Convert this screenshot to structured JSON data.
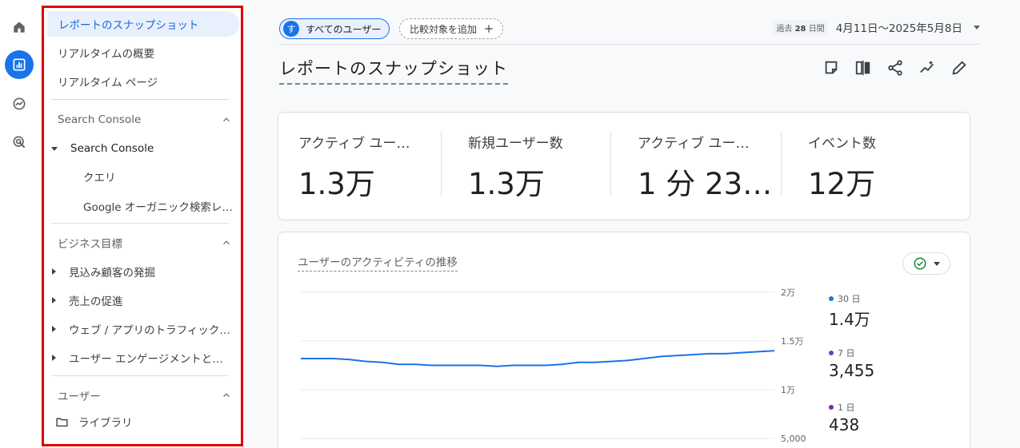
{
  "rail": {
    "items": [
      {
        "icon": "home-icon"
      },
      {
        "icon": "reports-icon",
        "active": true
      },
      {
        "icon": "explore-icon"
      },
      {
        "icon": "advertising-icon"
      }
    ]
  },
  "sidebar": {
    "snapshot": "レポートのスナップショット",
    "realtime_overview": "リアルタイムの概要",
    "realtime_pages": "リアルタイム ページ",
    "search_console_section": "Search Console",
    "search_console_group": "Search Console",
    "queries": "クエリ",
    "google_organic": "Google オーガニック検索レ…",
    "business_section": "ビジネス目標",
    "leads": "見込み顧客の発掘",
    "sales": "売上の促進",
    "traffic": "ウェブ / アプリのトラフィック…",
    "engagement": "ユーザー エンゲージメントと…",
    "user_section": "ユーザー",
    "library": "ライブラリ"
  },
  "header": {
    "user_chip_avatar": "す",
    "user_chip_label": "すべてのユーザー",
    "compare_label": "比較対象を追加",
    "date_badge_prefix": "過去",
    "date_badge_days": "28",
    "date_badge_suffix": "日間",
    "date_range": "4月11日～2025年5月8日",
    "page_title": "レポートのスナップショット"
  },
  "metrics": [
    {
      "label": "アクティブ ユー…",
      "value": "1.3万"
    },
    {
      "label": "新規ユーザー数",
      "value": "1.3万"
    },
    {
      "label": "アクティブ ユー…",
      "value": "1 分 23…"
    },
    {
      "label": "イベント数",
      "value": "12万"
    }
  ],
  "chart": {
    "title": "ユーザーのアクティビティの推移",
    "legend": [
      {
        "label": "30 日",
        "value": "1.4万",
        "color": "#1a73e8"
      },
      {
        "label": "7 日",
        "value": "3,455",
        "color": "#5a47c9"
      },
      {
        "label": "1 日",
        "value": "438",
        "color": "#7b2ab3"
      }
    ]
  },
  "chart_data": {
    "type": "line",
    "title": "ユーザーのアクティビティの推移",
    "y_ticks": [
      "2万",
      "1.5万",
      "1万",
      "5,000"
    ],
    "ylim": [
      5000,
      20000
    ],
    "grid": true,
    "series": [
      {
        "name": "30 日",
        "values": [
          13200,
          13200,
          13200,
          13100,
          12900,
          12800,
          12600,
          12600,
          12500,
          12500,
          12500,
          12500,
          12400,
          12500,
          12500,
          12500,
          12600,
          12800,
          12800,
          12900,
          13000,
          13200,
          13400,
          13500,
          13600,
          13700,
          13700,
          13800,
          13900,
          14000
        ]
      }
    ]
  }
}
